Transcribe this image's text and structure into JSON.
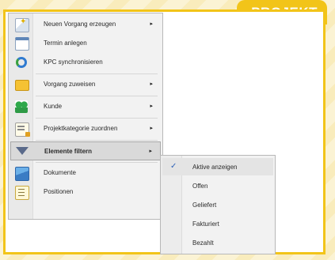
{
  "brand": {
    "label": "PROJEKT"
  },
  "menu": {
    "items": [
      {
        "label": "Neuen Vorgang erzeugen",
        "icon": "sparkle-doc-icon",
        "has_submenu": true
      },
      {
        "label": "Termin anlegen",
        "icon": "calendar-icon",
        "has_submenu": false
      },
      {
        "label": "KPC synchronisieren",
        "icon": "sync-icon",
        "has_submenu": false
      },
      {
        "label": "Vorgang zuweisen",
        "icon": "folder-icon",
        "has_submenu": true
      },
      {
        "label": "Kunde",
        "icon": "people-icon",
        "has_submenu": true
      },
      {
        "label": "Projektkategorie zuordnen",
        "icon": "category-icon",
        "has_submenu": true
      },
      {
        "label": "Elemente filtern",
        "icon": "filter-icon",
        "has_submenu": true
      },
      {
        "label": "Dokumente",
        "icon": "documents-icon",
        "has_submenu": false
      },
      {
        "label": "Positionen",
        "icon": "list-icon",
        "has_submenu": false
      }
    ],
    "submenu_arrow": "▸",
    "highlighted_index": 6
  },
  "submenu": {
    "items": [
      {
        "label": "Aktive anzeigen",
        "checked": true
      },
      {
        "label": "Offen",
        "checked": false
      },
      {
        "label": "Geliefert",
        "checked": false
      },
      {
        "label": "Fakturiert",
        "checked": false
      },
      {
        "label": "Bezahlt",
        "checked": false
      }
    ],
    "check_glyph": "✓"
  },
  "colors": {
    "accent": "#f2c419",
    "check": "#2f63b8"
  }
}
